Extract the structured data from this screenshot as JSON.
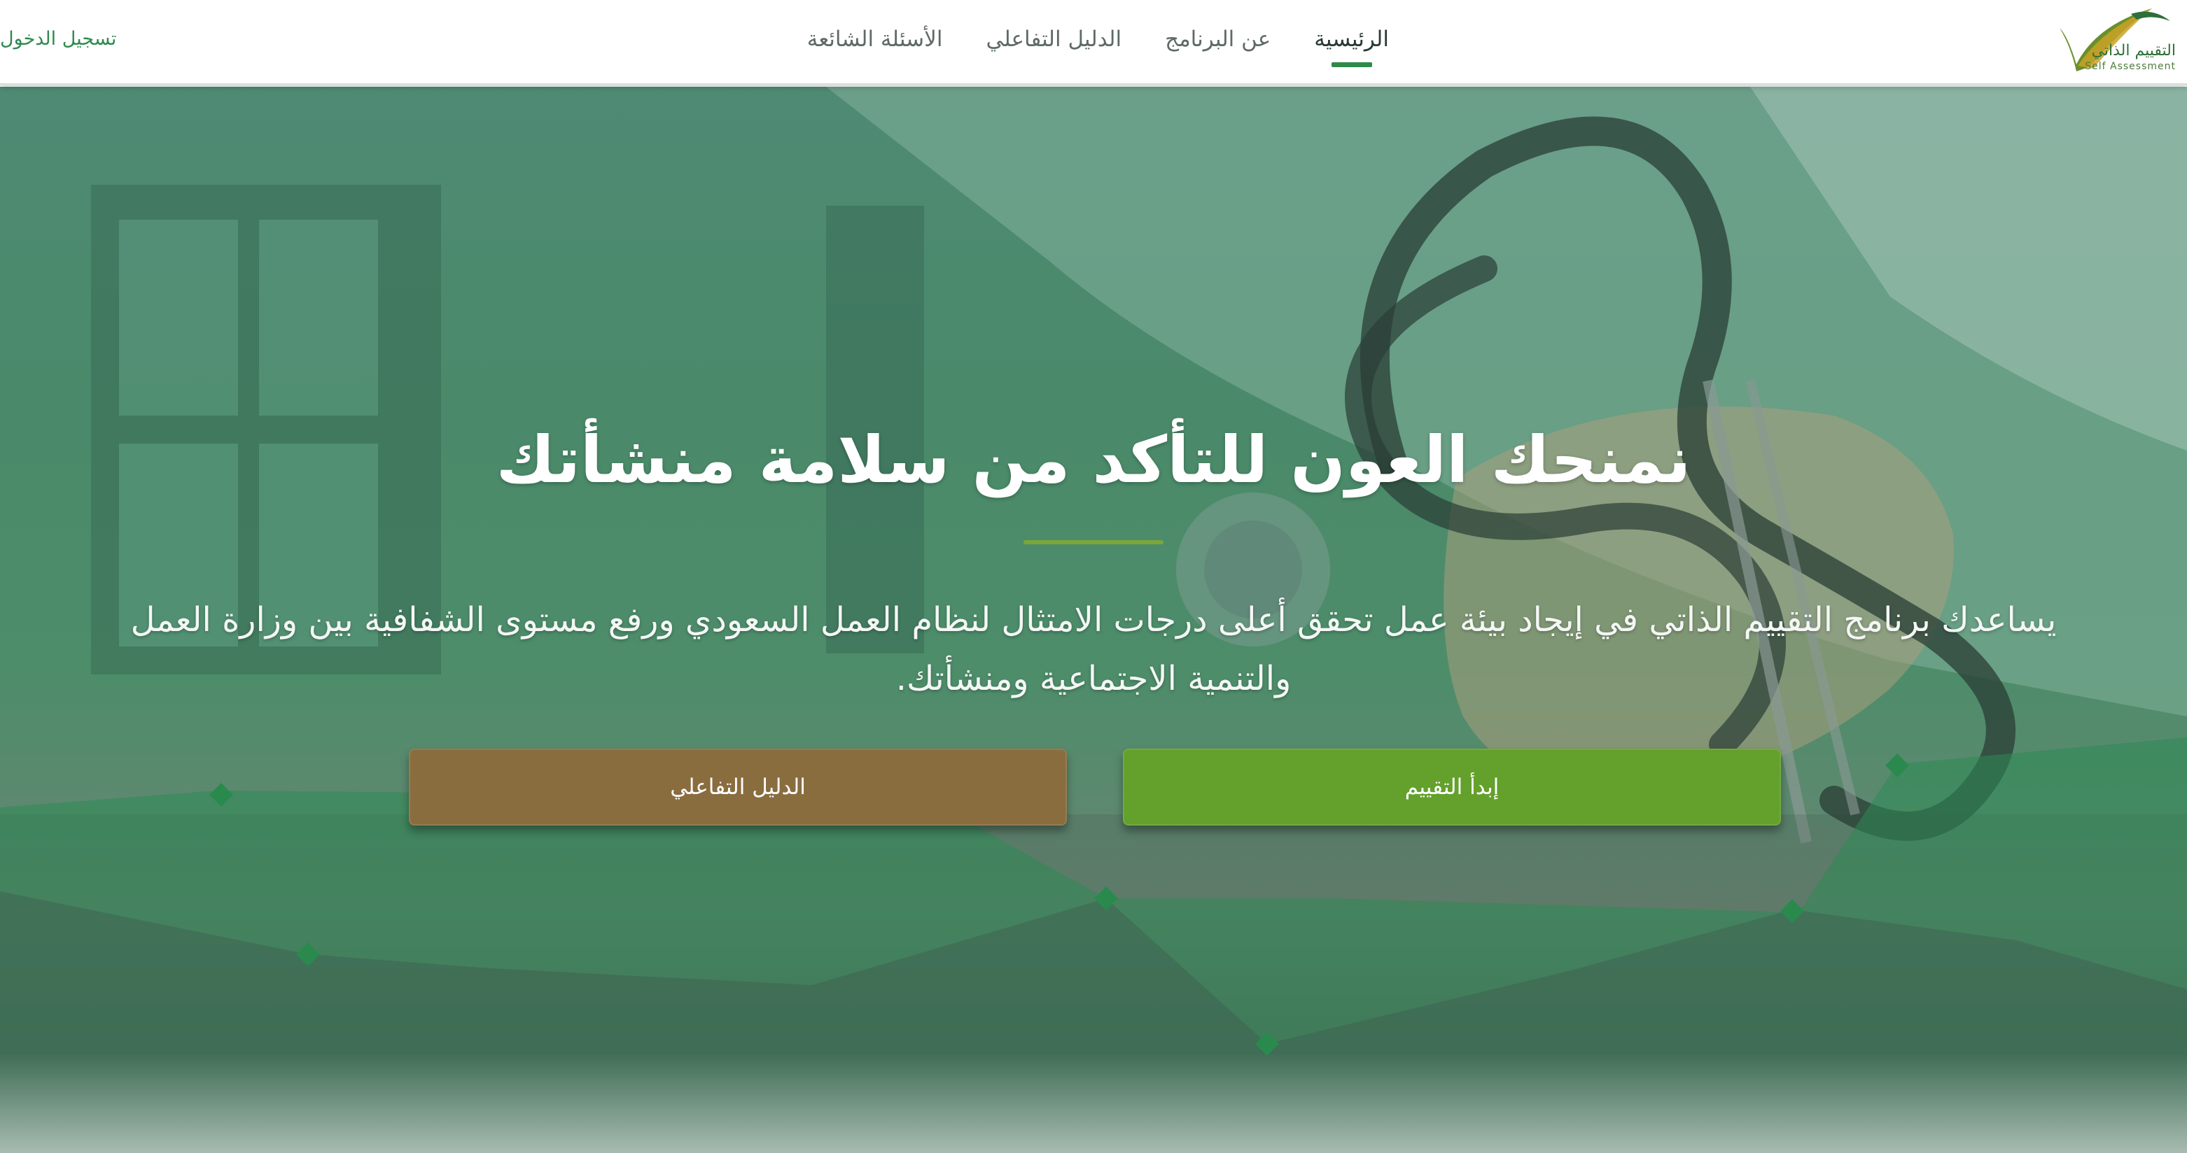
{
  "logo": {
    "title_ar": "التقييم الذاتي",
    "title_en": "Self Assessment"
  },
  "nav": {
    "items": [
      {
        "label": "الرئيسية",
        "active": true
      },
      {
        "label": "عن البرنامج",
        "active": false
      },
      {
        "label": "الدليل التفاعلي",
        "active": false
      },
      {
        "label": "الأسئلة الشائعة",
        "active": false
      }
    ],
    "login_label": "تسجيل الدخول"
  },
  "hero": {
    "title": "نمنحك العون للتأكد من سلامة منشأتك",
    "description": "يساعدك برنامج التقييم الذاتي في إيجاد بيئة عمل تحقق أعلى درجات الامتثال لنظام العمل السعودي ورفع مستوى الشفافية بين وزارة العمل والتنمية الاجتماعية ومنشأتك.",
    "start_button": "إبدأ التقييم",
    "guide_button": "الدليل التفاعلي"
  },
  "colors": {
    "accent_green": "#64a02c",
    "guide_brown": "#8a6d3f",
    "nav_underline": "#2d8a4a",
    "login_green": "#2f8a4f",
    "hero_overlay": "#4a8a6a"
  },
  "icons": {
    "logo": "checkmark-swoosh-logo"
  }
}
